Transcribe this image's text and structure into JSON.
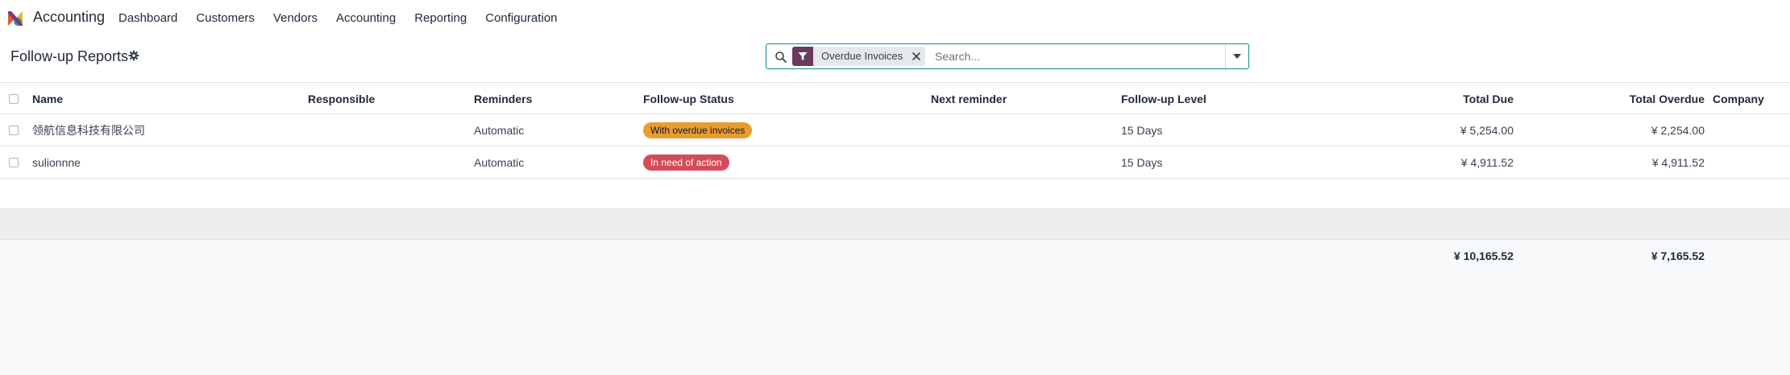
{
  "navbar": {
    "app_name": "Accounting",
    "menu": [
      "Dashboard",
      "Customers",
      "Vendors",
      "Accounting",
      "Reporting",
      "Configuration"
    ]
  },
  "control_panel": {
    "title": "Follow-up Reports",
    "search": {
      "facet_label": "Overdue Invoices",
      "placeholder": "Search..."
    }
  },
  "list": {
    "columns": {
      "name": "Name",
      "responsible": "Responsible",
      "reminders": "Reminders",
      "status": "Follow-up Status",
      "next_reminder": "Next reminder",
      "level": "Follow-up Level",
      "total_due": "Total Due",
      "total_overdue": "Total Overdue",
      "company": "Company"
    },
    "rows": [
      {
        "name": "领航信息科技有限公司",
        "responsible": "",
        "reminders": "Automatic",
        "status": "With overdue invoices",
        "status_color": "#e99d2e",
        "next_reminder": "",
        "level": "15 Days",
        "total_due": "¥ 5,254.00",
        "total_overdue": "¥ 2,254.00",
        "company": ""
      },
      {
        "name": "sulionnne",
        "responsible": "",
        "reminders": "Automatic",
        "status": "In need of action",
        "status_color": "#d44c59",
        "next_reminder": "",
        "level": "15 Days",
        "total_due": "¥ 4,911.52",
        "total_overdue": "¥ 4,911.52",
        "company": ""
      }
    ],
    "totals": {
      "total_due": "¥ 10,165.52",
      "total_overdue": "¥ 7,165.52"
    }
  },
  "icons": {
    "logo": "accounting-logo-icon",
    "gear": "gear-icon",
    "search": "search-icon",
    "filter": "filter-icon",
    "remove": "close-icon",
    "toggle": "caret-down-icon"
  },
  "colors": {
    "facet_icon_bg": "#6b3b5e",
    "search_border": "#0e8a96"
  }
}
